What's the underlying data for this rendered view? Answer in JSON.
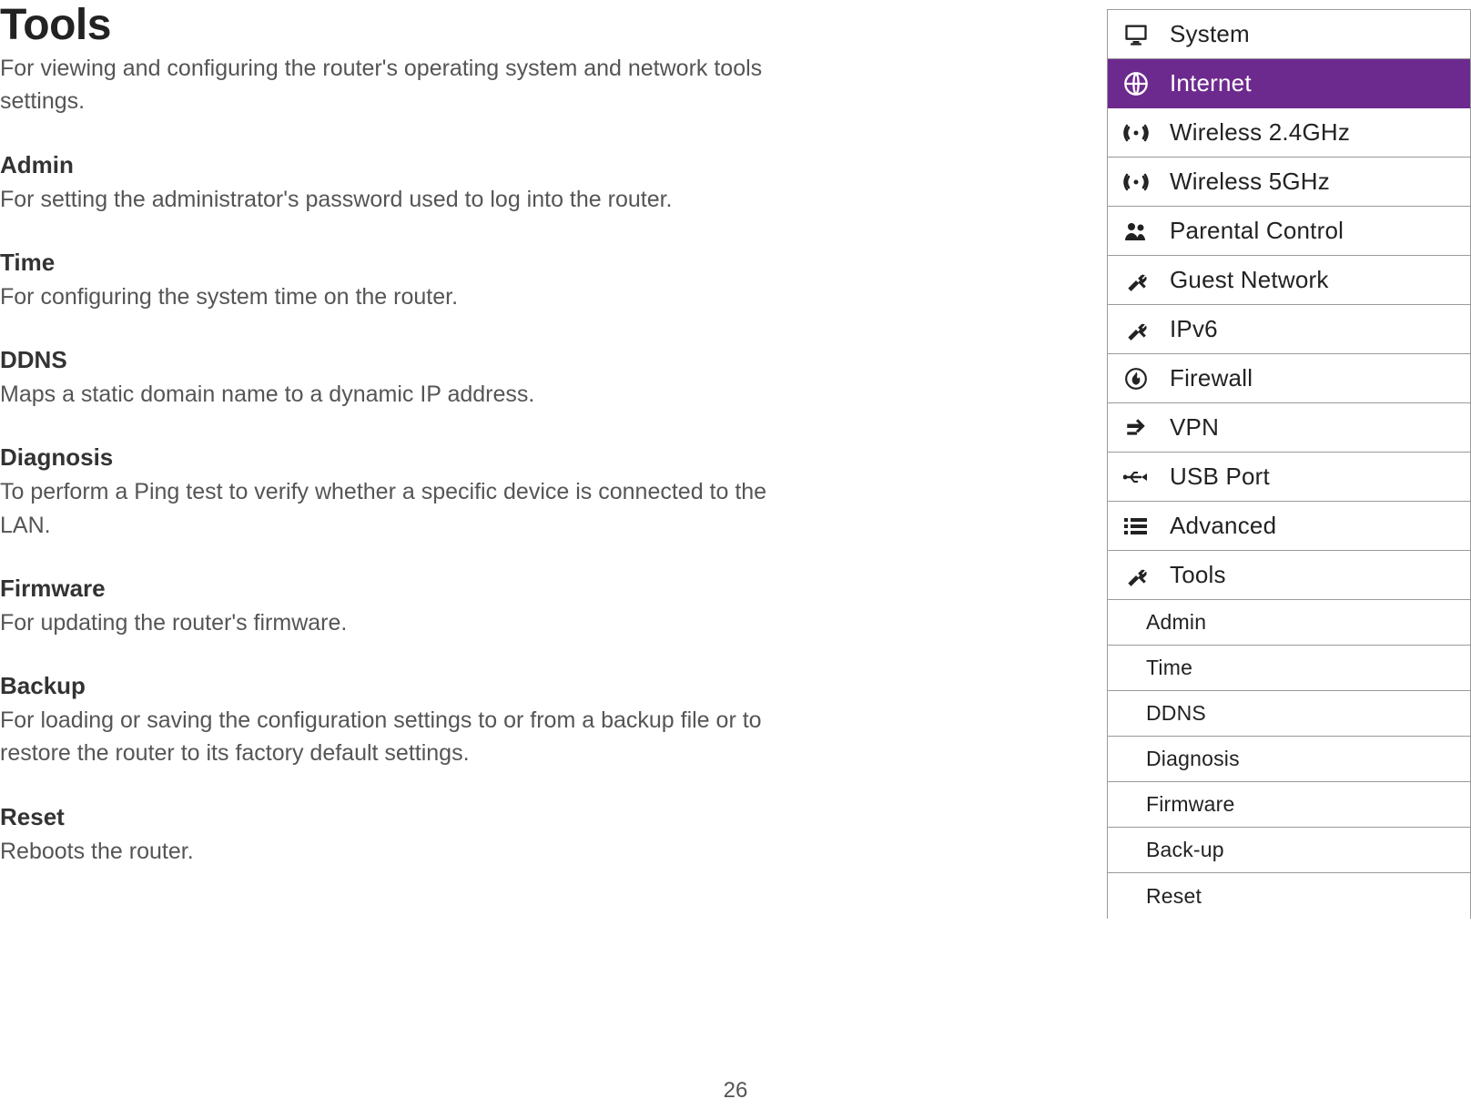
{
  "page": {
    "title": "Tools",
    "intro": "For viewing and configuring the router's operating system and network tools settings.",
    "sections": [
      {
        "title": "Admin",
        "desc": "For setting the administrator's password used to log into the router."
      },
      {
        "title": "Time",
        "desc": "For configuring the system time on the router."
      },
      {
        "title": "DDNS",
        "desc": "Maps a static domain name to a dynamic IP address."
      },
      {
        "title": "Diagnosis",
        "desc": "To perform a Ping test to verify whether a specific device is connected to the LAN."
      },
      {
        "title": "Firmware",
        "desc": "For updating the router's firmware."
      },
      {
        "title": "Backup",
        "desc": "For loading or saving the configuration settings to or from a backup file or to restore the router to its factory default settings."
      },
      {
        "title": "Reset",
        "desc": "Reboots the router."
      }
    ],
    "page_number": "26"
  },
  "menu": {
    "items": [
      {
        "label": "System",
        "icon": "monitor-icon",
        "selected": false
      },
      {
        "label": "Internet",
        "icon": "globe-icon",
        "selected": true
      },
      {
        "label": "Wireless 2.4GHz",
        "icon": "wifi-icon",
        "selected": false
      },
      {
        "label": "Wireless 5GHz",
        "icon": "wifi-icon",
        "selected": false
      },
      {
        "label": "Parental Control",
        "icon": "people-icon",
        "selected": false
      },
      {
        "label": "Guest Network",
        "icon": "tools-icon",
        "selected": false
      },
      {
        "label": "IPv6",
        "icon": "tools-icon",
        "selected": false
      },
      {
        "label": "Firewall",
        "icon": "flame-icon",
        "selected": false
      },
      {
        "label": "VPN",
        "icon": "arrows-icon",
        "selected": false
      },
      {
        "label": "USB Port",
        "icon": "usb-icon",
        "selected": false
      },
      {
        "label": "Advanced",
        "icon": "list-icon",
        "selected": false
      },
      {
        "label": "Tools",
        "icon": "tools-icon",
        "selected": false
      }
    ],
    "sub_items": [
      {
        "label": "Admin"
      },
      {
        "label": "Time"
      },
      {
        "label": "DDNS"
      },
      {
        "label": "Diagnosis"
      },
      {
        "label": "Firmware"
      },
      {
        "label": "Back-up"
      },
      {
        "label": "Reset"
      }
    ]
  }
}
